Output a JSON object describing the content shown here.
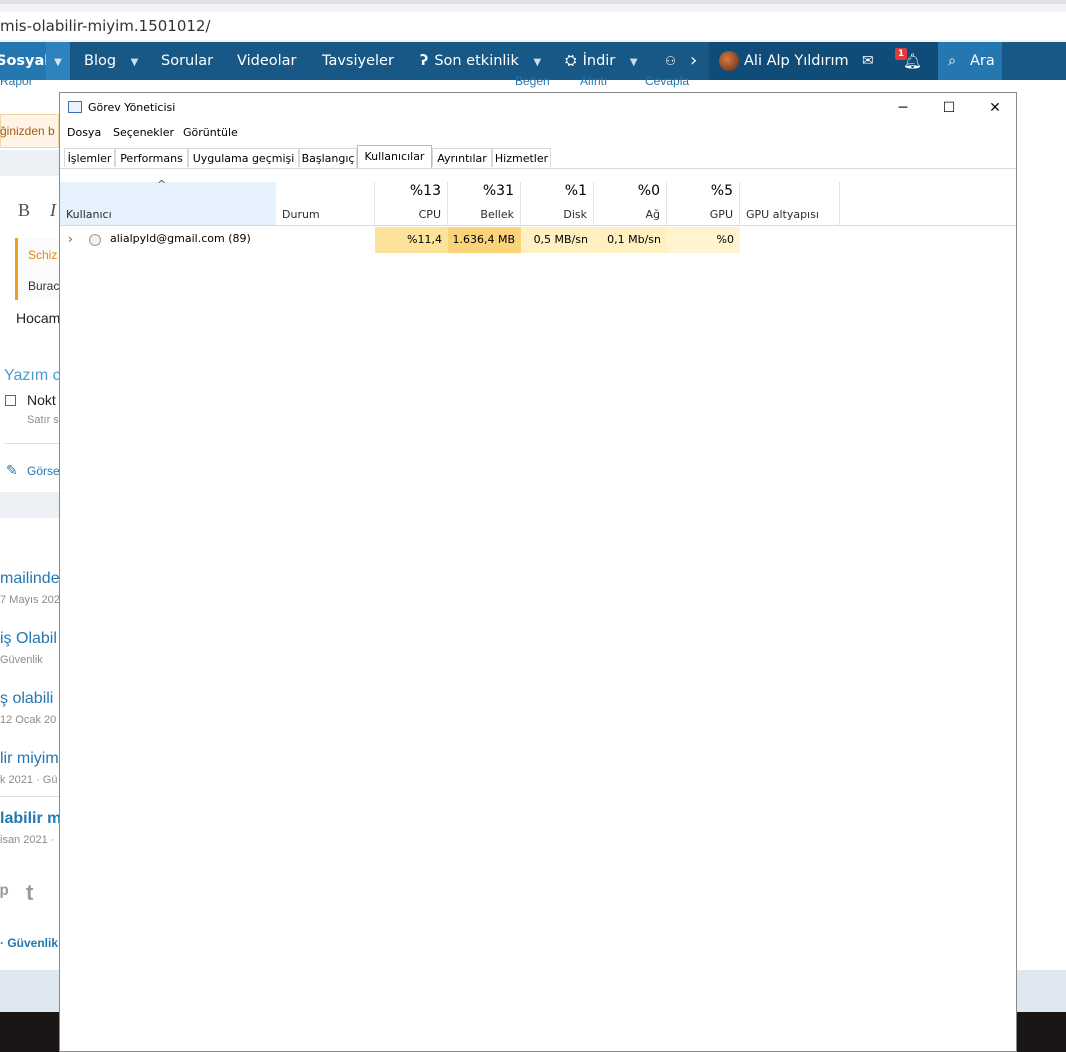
{
  "browser": {
    "url_fragment": "mis-olabilir-miyim.1501012/"
  },
  "site_nav": {
    "items": [
      {
        "label": "Sosyal"
      },
      {
        "label": "Blog"
      },
      {
        "label": "Sorular"
      },
      {
        "label": "Videolar"
      },
      {
        "label": "Tavsiyeler"
      },
      {
        "label": "Son etkinlik"
      },
      {
        "label": "İndir"
      }
    ],
    "user_name": "Ali Alp Yıldırım",
    "notification_count": "1",
    "search_label": "Ara"
  },
  "page_background": {
    "under_nav": [
      "Rapor",
      "Beğen",
      "Alıntı",
      "Cevapla"
    ],
    "notice_text": "ğinizden b",
    "editor_bold": "B",
    "editor_italic": "I",
    "quote_title": "Schiz",
    "quote_body": "Burac",
    "reply_text": "Hocam",
    "section_title": "Yazım c",
    "checkbox_label": "Nokt",
    "checkbox_sub": "Satır s",
    "attach_label": "Görse",
    "similar": [
      {
        "title": "mailinde",
        "meta": "7 Mayıs 202"
      },
      {
        "title": "iş Olabil",
        "meta": "Güvenlik"
      },
      {
        "title": "ş olabili",
        "meta": "12 Ocak 20"
      },
      {
        "title": "lir miyim",
        "meta": "k 2021 · Gü"
      },
      {
        "title": "labilir m",
        "meta": "isan 2021 ·"
      }
    ],
    "share_t": "t",
    "footer_link": "· Güvenlik"
  },
  "task_manager": {
    "window_title": "Görev Yöneticisi",
    "window_buttons": {
      "minimize": "─",
      "maximize": "☐",
      "close": "✕"
    },
    "menu": [
      "Dosya",
      "Seçenekler",
      "Görüntüle"
    ],
    "tabs": [
      {
        "label": "İşlemler"
      },
      {
        "label": "Performans"
      },
      {
        "label": "Uygulama geçmişi"
      },
      {
        "label": "Başlangıç"
      },
      {
        "label": "Kullanıcılar"
      },
      {
        "label": "Ayrıntılar"
      },
      {
        "label": "Hizmetler"
      }
    ],
    "active_tab": "Kullanıcılar",
    "sort_indicator": "^",
    "columns": [
      {
        "label": "Kullanıcı",
        "pct": ""
      },
      {
        "label": "Durum",
        "pct": ""
      },
      {
        "label": "CPU",
        "pct": "%13"
      },
      {
        "label": "Bellek",
        "pct": "%31"
      },
      {
        "label": "Disk",
        "pct": "%1"
      },
      {
        "label": "Ağ",
        "pct": "%0"
      },
      {
        "label": "GPU",
        "pct": "%5"
      },
      {
        "label": "GPU altyapısı",
        "pct": ""
      }
    ],
    "rows": [
      {
        "user": "alialpyld@gmail.com (89)",
        "status": "",
        "cpu": "%11,4",
        "memory": "1.636,4 MB",
        "disk": "0,5 MB/sn",
        "network": "0,1 Mb/sn",
        "gpu": "%0",
        "gpu_engine": ""
      }
    ],
    "heat_colors": {
      "cpu": "#fde39a",
      "memory": "#fbd37a",
      "disk": "#fff0c2",
      "network": "#fff0c2",
      "gpu": "#fff4cf"
    },
    "sorted_header_color": "#e5f2fd"
  }
}
